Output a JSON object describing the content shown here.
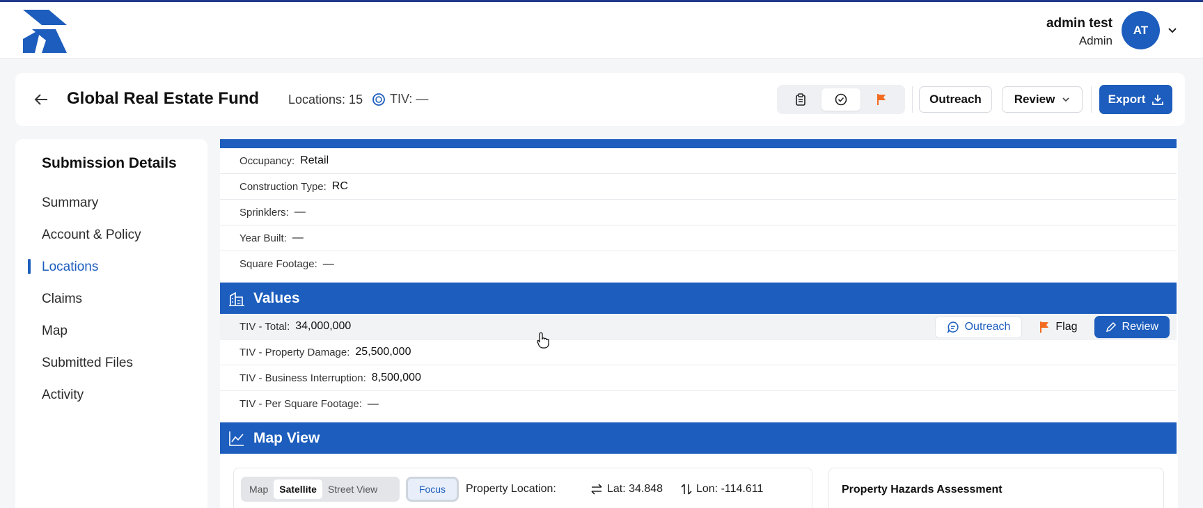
{
  "user": {
    "name": "admin test",
    "role": "Admin",
    "initials": "AT"
  },
  "header": {
    "title": "Global Real Estate Fund",
    "locations_label": "Locations: 15",
    "tiv_label": "TIV: —",
    "outreach_label": "Outreach",
    "review_label": "Review",
    "export_label": "Export"
  },
  "sidebar": {
    "title": "Submission Details",
    "items": [
      {
        "label": "Summary"
      },
      {
        "label": "Account & Policy"
      },
      {
        "label": "Locations"
      },
      {
        "label": "Claims"
      },
      {
        "label": "Map"
      },
      {
        "label": "Submitted Files"
      },
      {
        "label": "Activity"
      }
    ],
    "active_index": 2
  },
  "building": {
    "rows": [
      {
        "label": "Occupancy:",
        "value": "Retail"
      },
      {
        "label": "Construction Type:",
        "value": "RC"
      },
      {
        "label": "Sprinklers:",
        "value": "—"
      },
      {
        "label": "Year Built:",
        "value": "—"
      },
      {
        "label": "Square Footage:",
        "value": "—"
      }
    ]
  },
  "values": {
    "title": "Values",
    "rows": [
      {
        "label": "TIV - Total:",
        "value": "34,000,000"
      },
      {
        "label": "TIV - Property Damage:",
        "value": "25,500,000"
      },
      {
        "label": "TIV - Business Interruption:",
        "value": "8,500,000"
      },
      {
        "label": "TIV - Per Square Footage:",
        "value": "—"
      }
    ],
    "row_actions": {
      "outreach": "Outreach",
      "flag": "Flag",
      "review": "Review"
    }
  },
  "map_view": {
    "title": "Map View",
    "toggle": [
      "Map",
      "Satellite",
      "Street View"
    ],
    "active_toggle": "Satellite",
    "focus_label": "Focus",
    "property_location_label": "Property Location:",
    "lat": "Lat: 34.848",
    "lon": "Lon: -114.611",
    "hazards_title": "Property Hazards Assessment"
  },
  "colors": {
    "primary": "#1c5dbd",
    "flag": "#f26b21"
  }
}
